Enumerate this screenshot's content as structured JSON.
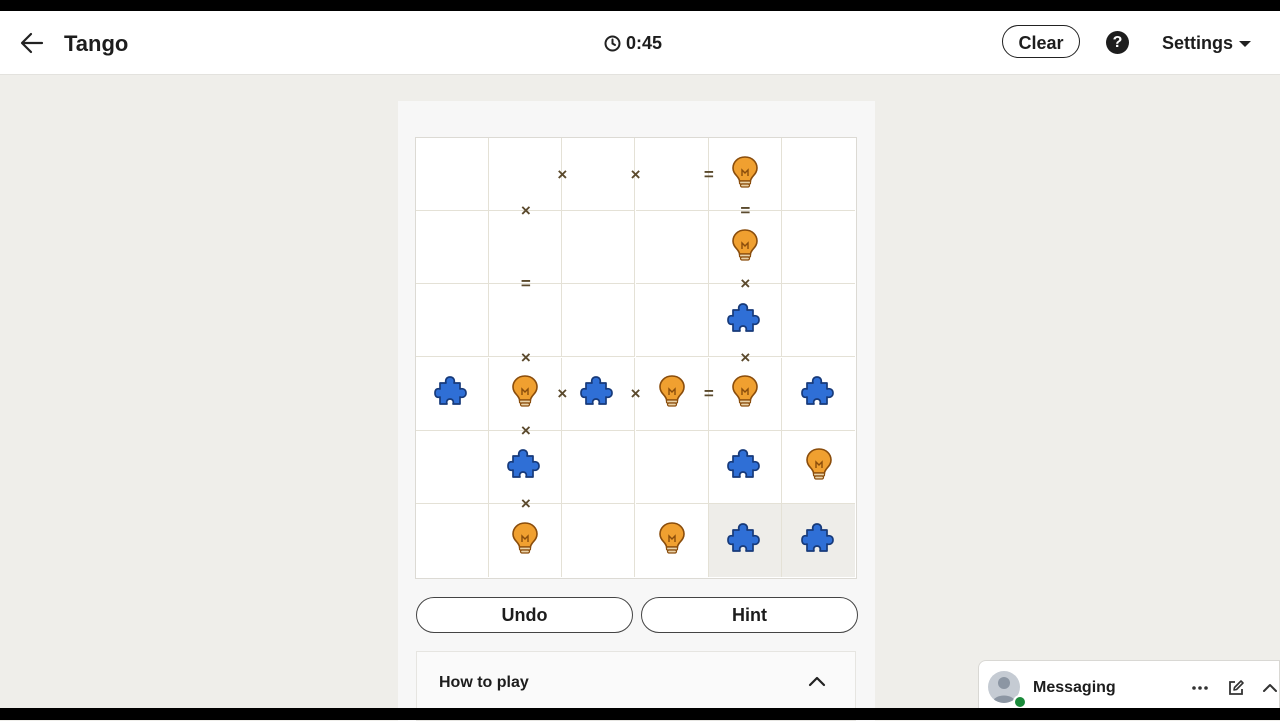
{
  "header": {
    "title": "Tango",
    "timer": "0:45",
    "clear_label": "Clear",
    "help_label": "?",
    "settings_label": "Settings"
  },
  "board": {
    "size": 6,
    "cells": [
      [
        "",
        "",
        "",
        "",
        "sun",
        ""
      ],
      [
        "",
        "",
        "",
        "",
        "sun",
        ""
      ],
      [
        "",
        "",
        "",
        "",
        "moon",
        ""
      ],
      [
        "moon",
        "sun",
        "moon",
        "sun",
        "sun",
        "moon"
      ],
      [
        "",
        "moon",
        "",
        "",
        "moon",
        "sun"
      ],
      [
        "",
        "sun",
        "",
        "sun",
        "moon",
        "moon"
      ]
    ],
    "locked": [
      [
        5,
        4
      ],
      [
        5,
        5
      ]
    ],
    "constraints_h": [
      {
        "r": 0,
        "c": 1,
        "t": "×"
      },
      {
        "r": 0,
        "c": 2,
        "t": "×"
      },
      {
        "r": 0,
        "c": 3,
        "t": "="
      },
      {
        "r": 3,
        "c": 1,
        "t": "×"
      },
      {
        "r": 3,
        "c": 2,
        "t": "×"
      },
      {
        "r": 3,
        "c": 3,
        "t": "="
      }
    ],
    "constraints_v": [
      {
        "r": 0,
        "c": 1,
        "t": "×"
      },
      {
        "r": 0,
        "c": 4,
        "t": "="
      },
      {
        "r": 1,
        "c": 1,
        "t": "="
      },
      {
        "r": 1,
        "c": 4,
        "t": "×"
      },
      {
        "r": 2,
        "c": 1,
        "t": "×"
      },
      {
        "r": 2,
        "c": 4,
        "t": "×"
      },
      {
        "r": 3,
        "c": 1,
        "t": "×"
      },
      {
        "r": 4,
        "c": 1,
        "t": "×"
      }
    ],
    "icons": {
      "sun": "lightbulb-icon",
      "moon": "puzzle-piece-icon"
    },
    "colors": {
      "sun": "#f0a030",
      "moon": "#2f6fd6"
    }
  },
  "actions": {
    "undo_label": "Undo",
    "hint_label": "Hint"
  },
  "howto": {
    "title": "How to play"
  },
  "messaging": {
    "label": "Messaging"
  }
}
